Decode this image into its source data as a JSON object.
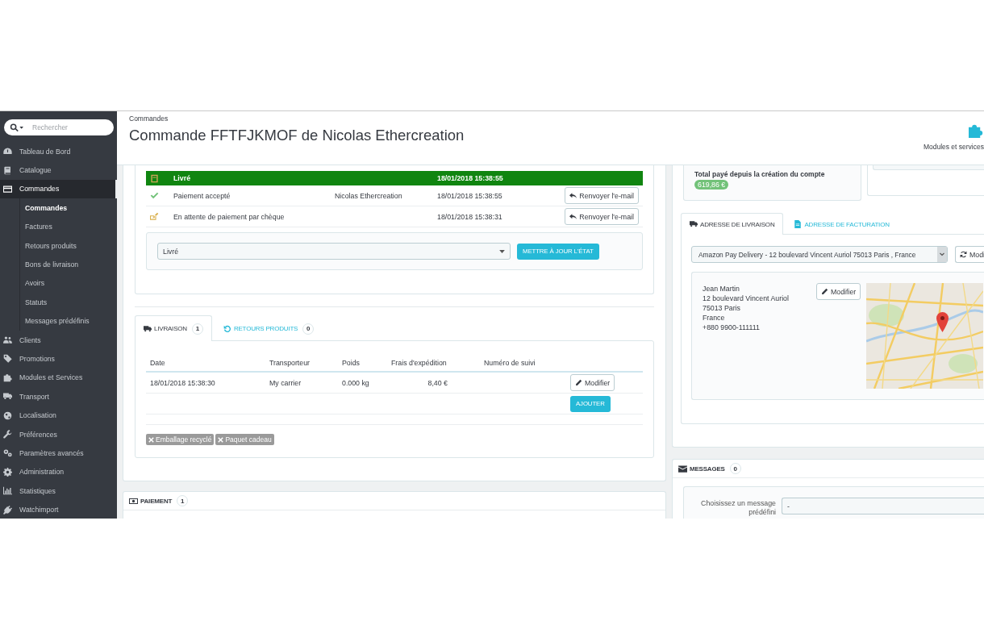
{
  "sidebar": {
    "search": {
      "placeholder": "Rechercher"
    },
    "items": [
      {
        "label": "Tableau de Bord",
        "selected": false,
        "expanded": false
      },
      {
        "label": "Catalogue",
        "selected": false,
        "expanded": false
      },
      {
        "label": "Commandes",
        "selected": true,
        "expanded": true,
        "children": [
          {
            "label": "Commandes",
            "selected": true
          },
          {
            "label": "Factures",
            "selected": false
          },
          {
            "label": "Retours produits",
            "selected": false
          },
          {
            "label": "Bons de livraison",
            "selected": false
          },
          {
            "label": "Avoirs",
            "selected": false
          },
          {
            "label": "Statuts",
            "selected": false
          },
          {
            "label": "Messages prédéfinis",
            "selected": false
          }
        ]
      },
      {
        "label": "Clients",
        "selected": false,
        "expanded": false
      },
      {
        "label": "Promotions",
        "selected": false,
        "expanded": false
      },
      {
        "label": "Modules et Services",
        "selected": false,
        "expanded": false
      },
      {
        "label": "Transport",
        "selected": false,
        "expanded": false
      },
      {
        "label": "Localisation",
        "selected": false,
        "expanded": false
      },
      {
        "label": "Préférences",
        "selected": false,
        "expanded": false
      },
      {
        "label": "Paramètres avancés",
        "selected": false,
        "expanded": false
      },
      {
        "label": "Administration",
        "selected": false,
        "expanded": false
      },
      {
        "label": "Statistiques",
        "selected": false,
        "expanded": false
      },
      {
        "label": "Watchimport",
        "selected": false,
        "expanded": false
      }
    ]
  },
  "header": {
    "breadcrumb": "Commandes",
    "title": "Commande FFTFJKMOF de Nicolas Ethercreation",
    "toolbar": [
      {
        "label": "Modules et services"
      }
    ]
  },
  "order_history": {
    "rows": [
      {
        "status": "Livré",
        "date": "18/01/2018 15:38:55",
        "current": true,
        "color": "#108510"
      },
      {
        "status": "Paiement accepté",
        "employee": "Nicolas Ethercreation",
        "date": "18/01/2018 15:38:55",
        "current": false,
        "action": "Renvoyer l'e-mail"
      },
      {
        "status": "En attente de paiement par chèque",
        "date": "18/01/2018 15:38:31",
        "current": false,
        "action": "Renvoyer l'e-mail"
      }
    ]
  },
  "status_form": {
    "select": {
      "value": "Livré"
    },
    "button": "METTRE À JOUR L'ÉTAT"
  },
  "shipping": {
    "tabs": [
      {
        "label": "LIVRAISON",
        "count": "1",
        "selected": true
      },
      {
        "label": "RETOURS PRODUITS",
        "count": "0",
        "selected": false
      }
    ],
    "table": {
      "columns": [
        "Date",
        "Transporteur",
        "Poids",
        "Frais d'expédition",
        "Numéro de suivi"
      ],
      "rows": [
        {
          "date": "18/01/2018 15:38:30",
          "carrier": "My carrier",
          "weight": "0.000 kg",
          "cost": "8,40 €",
          "action": "Modifier"
        }
      ]
    },
    "add_button": "AJOUTER",
    "tags": [
      "Emballage recyclé",
      "Paquet cadeau"
    ]
  },
  "payment": {
    "title": "PAIEMENT",
    "count": "1"
  },
  "customer": {
    "total_label": "Total payé depuis la création du compte",
    "total": "619,86 €"
  },
  "addresses": {
    "tabs": [
      {
        "label": "ADRESSE DE LIVRAISON",
        "selected": true
      },
      {
        "label": "ADRESSE DE FACTURATION",
        "selected": false
      }
    ],
    "select": {
      "value": "Amazon Pay Delivery - 12 boulevard Vincent Auriol 75013 Paris , France"
    },
    "change_button": "Modi",
    "address_lines": [
      "Jean Martin",
      "12 boulevard Vincent Auriol",
      "75013 Paris",
      "France",
      "+880 9900-111111"
    ],
    "edit_button": "Modifier"
  },
  "messages": {
    "title": "MESSAGES",
    "count": "0",
    "label": "Choisissez un message prédéfini",
    "select": {
      "value": "-"
    }
  }
}
